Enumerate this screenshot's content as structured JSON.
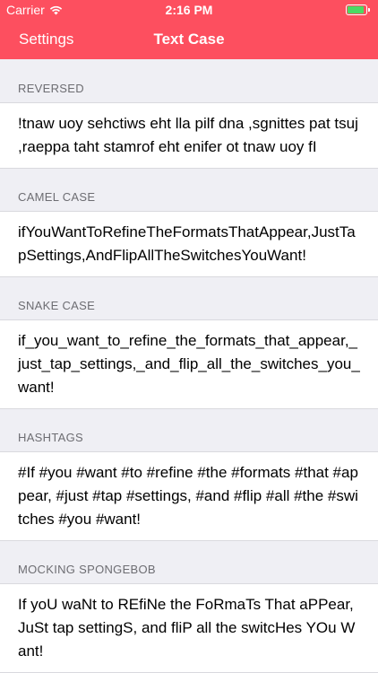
{
  "status_bar": {
    "carrier": "Carrier",
    "time": "2:16 PM",
    "battery_level": 0.9
  },
  "nav": {
    "back_label": "Settings",
    "title": "Text Case"
  },
  "colors": {
    "accent": "#fd4f5f",
    "background": "#efeff4",
    "battery": "#4cd964"
  },
  "sections": [
    {
      "header": "REVERSED",
      "text": "!tnaw uoy sehctiws eht lla pilf dna ,sgnittes pat tsuj ,raeppa taht stamrof eht enifer ot tnaw uoy fI"
    },
    {
      "header": "CAMEL CASE",
      "text": "ifYouWantToRefineTheFormatsThatAppear,JustTapSettings,AndFlipAllTheSwitchesYouWant!"
    },
    {
      "header": "SNAKE CASE",
      "text": "if_you_want_to_refine_the_formats_that_appear,_just_tap_settings,_and_flip_all_the_switches_you_want!"
    },
    {
      "header": "HASHTAGS",
      "text": "#If #you #want #to #refine #the #formats #that #appear, #just #tap #settings, #and #flip #all #the #switches #you #want!"
    },
    {
      "header": "MOCKING SPONGEBOB",
      "text": "If yoU waNt to REfiNe the FoRmaTs That aPPear, JuSt tap settingS, and fliP all the switcHes YOu Want!"
    }
  ]
}
